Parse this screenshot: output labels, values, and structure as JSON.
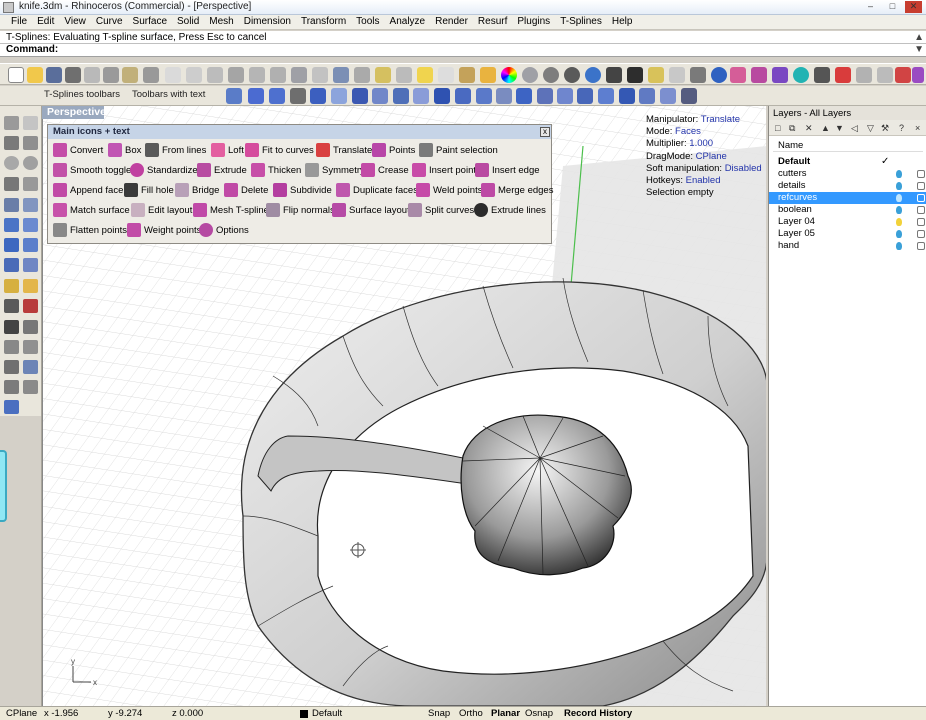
{
  "window": {
    "title": "knife.3dm - Rhinoceros (Commercial) - [Perspective]",
    "minimize_glyph": "–",
    "maximize_glyph": "□",
    "close_glyph": "✕"
  },
  "menu": [
    "File",
    "Edit",
    "View",
    "Curve",
    "Surface",
    "Solid",
    "Mesh",
    "Dimension",
    "Transform",
    "Tools",
    "Analyze",
    "Render",
    "Resurf",
    "Plugins",
    "T-Splines",
    "Help"
  ],
  "status_message": "T-Splines: Evaluating T-spline surface, Press Esc to cancel",
  "command_label": "Command:",
  "toolbar_tabs": {
    "tsplines": "T-Splines toolbars",
    "with_text": "Toolbars with text"
  },
  "viewport": {
    "label": "Perspective",
    "axis_y": "y",
    "axis_x": "x"
  },
  "floating_toolbar": {
    "title": "Main icons + text",
    "close_glyph": "x",
    "rows": [
      [
        "Convert",
        "Box",
        "From lines",
        "Loft",
        "Fit to curves",
        "Translate",
        "Points",
        "Paint selection"
      ],
      [
        "Smooth toggle",
        "Standardize",
        "Extrude",
        "Thicken",
        "Symmetry",
        "Crease",
        "Insert point",
        "Insert edge"
      ],
      [
        "Append face",
        "Fill hole",
        "Bridge",
        "Delete",
        "Subdivide",
        "Duplicate faces",
        "Weld points",
        "Merge edges"
      ],
      [
        "Match surface",
        "Edit layout",
        "Mesh T-spline",
        "Flip normals",
        "Surface layout",
        "Split curves",
        "Extrude lines"
      ],
      [
        "Flatten points",
        "Weight points",
        "Options"
      ]
    ]
  },
  "manipulator_info": {
    "manipulator_label": "Manipulator:",
    "manipulator_value": "Translate",
    "mode_label": "Mode:",
    "mode_value": "Faces",
    "multiplier_label": "Multiplier:",
    "multiplier_value": "1.000",
    "dragmode_label": "DragMode:",
    "dragmode_value": "CPlane",
    "soft_label": "Soft manipulation:",
    "soft_value": "Disabled",
    "hotkeys_label": "Hotkeys:",
    "hotkeys_value": "Enabled",
    "selection": "Selection empty"
  },
  "layers_panel": {
    "title": "Layers - All Layers",
    "column_name": "Name",
    "current_check": "✓",
    "layers": [
      {
        "name": "Default",
        "bulb_color": "#ffffff"
      },
      {
        "name": "cutters",
        "bulb_color": "#3aa0d8"
      },
      {
        "name": "details",
        "bulb_color": "#3aa0d8"
      },
      {
        "name": "refcurves",
        "bulb_color": "#3aa0d8"
      },
      {
        "name": "boolean",
        "bulb_color": "#3aa0d8"
      },
      {
        "name": "Layer 04",
        "bulb_color": "#f2d23a"
      },
      {
        "name": "Layer 05",
        "bulb_color": "#3aa0d8"
      },
      {
        "name": "hand",
        "bulb_color": "#3aa0d8"
      }
    ],
    "selected_layer": "refcurves"
  },
  "statusbar": {
    "cplane": "CPlane",
    "x": "x -1.956",
    "y": "y -9.274",
    "z": "z 0.000",
    "layer": "Default",
    "snap": "Snap",
    "ortho": "Ortho",
    "planar": "Planar",
    "osnap": "Osnap",
    "record_history": "Record History"
  },
  "colors": {
    "accent": "#3399ff",
    "info_value": "#2233aa",
    "close_red": "#c73d2f",
    "viewport_tab": "#9aa9bf"
  }
}
